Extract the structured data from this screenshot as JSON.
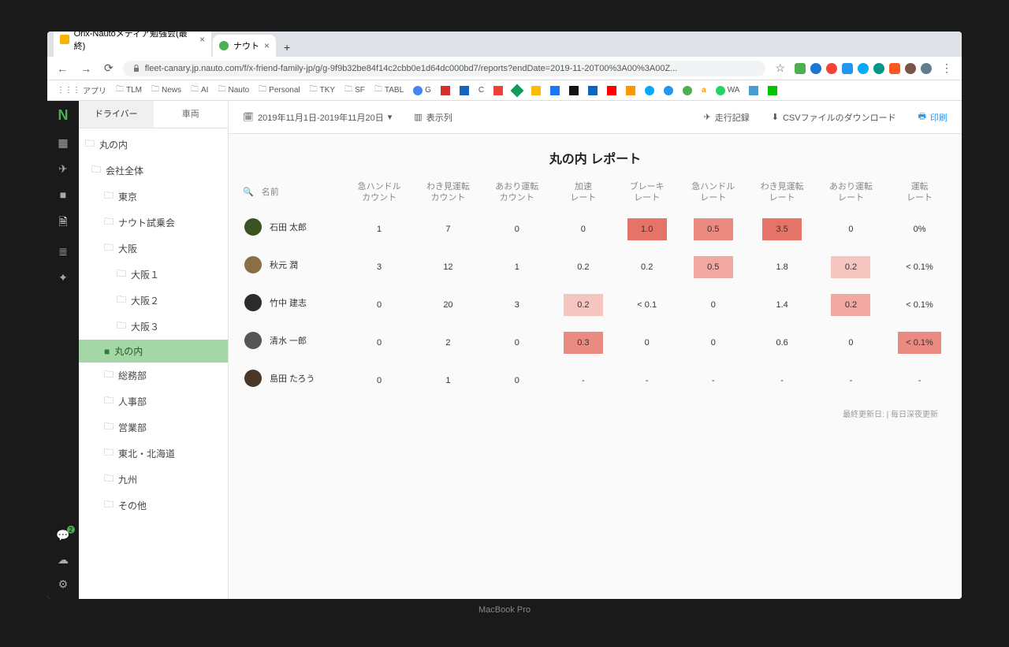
{
  "browser": {
    "tabs": [
      {
        "title": "Orix-Nautoメディア勉強会(最終)"
      },
      {
        "title": "ナウト"
      }
    ],
    "url": "fleet-canary.jp.nauto.com/f/x-friend-family-jp/g/g-9f9b32be84f14c2cbb0e1d64dc000bd7/reports?endDate=2019-11-20T00%3A00%3A00Z...",
    "bookmarks": [
      "アプリ",
      "TLM",
      "News",
      "AI",
      "Nauto",
      "Personal",
      "TKY",
      "SF",
      "TABL"
    ]
  },
  "sidebar": {
    "tabs": {
      "driver": "ドライバー",
      "vehicle": "車両"
    },
    "root": "丸の内",
    "tree": [
      {
        "label": "会社全体",
        "level": 1
      },
      {
        "label": "東京",
        "level": 2
      },
      {
        "label": "ナウト試乗会",
        "level": 2
      },
      {
        "label": "大阪",
        "level": 2
      },
      {
        "label": "大阪１",
        "level": 3
      },
      {
        "label": "大阪２",
        "level": 3
      },
      {
        "label": "大阪３",
        "level": 3
      },
      {
        "label": "丸の内",
        "level": 2,
        "selected": true
      },
      {
        "label": "総務部",
        "level": 2
      },
      {
        "label": "人事部",
        "level": 2
      },
      {
        "label": "営業部",
        "level": 2
      },
      {
        "label": "東北・北海道",
        "level": 2
      },
      {
        "label": "九州",
        "level": 2
      },
      {
        "label": "その他",
        "level": 2
      }
    ]
  },
  "toolbar": {
    "date_range": "2019年11月1日-2019年11月20日",
    "columns": "表示列",
    "trip_log": "走行記録",
    "csv": "CSVファイルのダウンロード",
    "print": "印刷"
  },
  "report": {
    "title": "丸の内 レポート",
    "name_header": "名前",
    "columns": [
      "急ハンドルカウント",
      "わき見運転カウント",
      "あおり運転カウント",
      "加速 レート",
      "ブレーキレート",
      "急ハンドルレート",
      "わき見運転レート",
      "あおり運転レート",
      "運転レート"
    ],
    "rows": [
      {
        "name": "石田 太郎",
        "v": [
          "1",
          "7",
          "0",
          "0",
          "1.0",
          "0.5",
          "3.5",
          "0",
          "0%"
        ],
        "heat": [
          0,
          0,
          0,
          0,
          4,
          3,
          4,
          0,
          0
        ]
      },
      {
        "name": "秋元 潤",
        "v": [
          "3",
          "12",
          "1",
          "0.2",
          "0.2",
          "0.5",
          "1.8",
          "0.2",
          "< 0.1%"
        ],
        "heat": [
          0,
          0,
          0,
          0,
          0,
          2,
          0,
          1,
          0
        ]
      },
      {
        "name": "竹中 建志",
        "v": [
          "0",
          "20",
          "3",
          "0.2",
          "< 0.1",
          "0",
          "1.4",
          "0.2",
          "< 0.1%"
        ],
        "heat": [
          0,
          0,
          0,
          1,
          0,
          0,
          0,
          2,
          0
        ]
      },
      {
        "name": "清水 一郎",
        "v": [
          "0",
          "2",
          "0",
          "0.3",
          "0",
          "0",
          "0.6",
          "0",
          "< 0.1%"
        ],
        "heat": [
          0,
          0,
          0,
          3,
          0,
          0,
          0,
          0,
          3
        ]
      },
      {
        "name": "島田 たろう",
        "v": [
          "0",
          "1",
          "0",
          "-",
          "-",
          "-",
          "-",
          "-",
          "-"
        ],
        "heat": [
          0,
          0,
          0,
          0,
          0,
          0,
          0,
          0,
          0
        ]
      }
    ],
    "footer": "最終更新日: | 毎日深夜更新"
  },
  "laptop": "MacBook Pro"
}
